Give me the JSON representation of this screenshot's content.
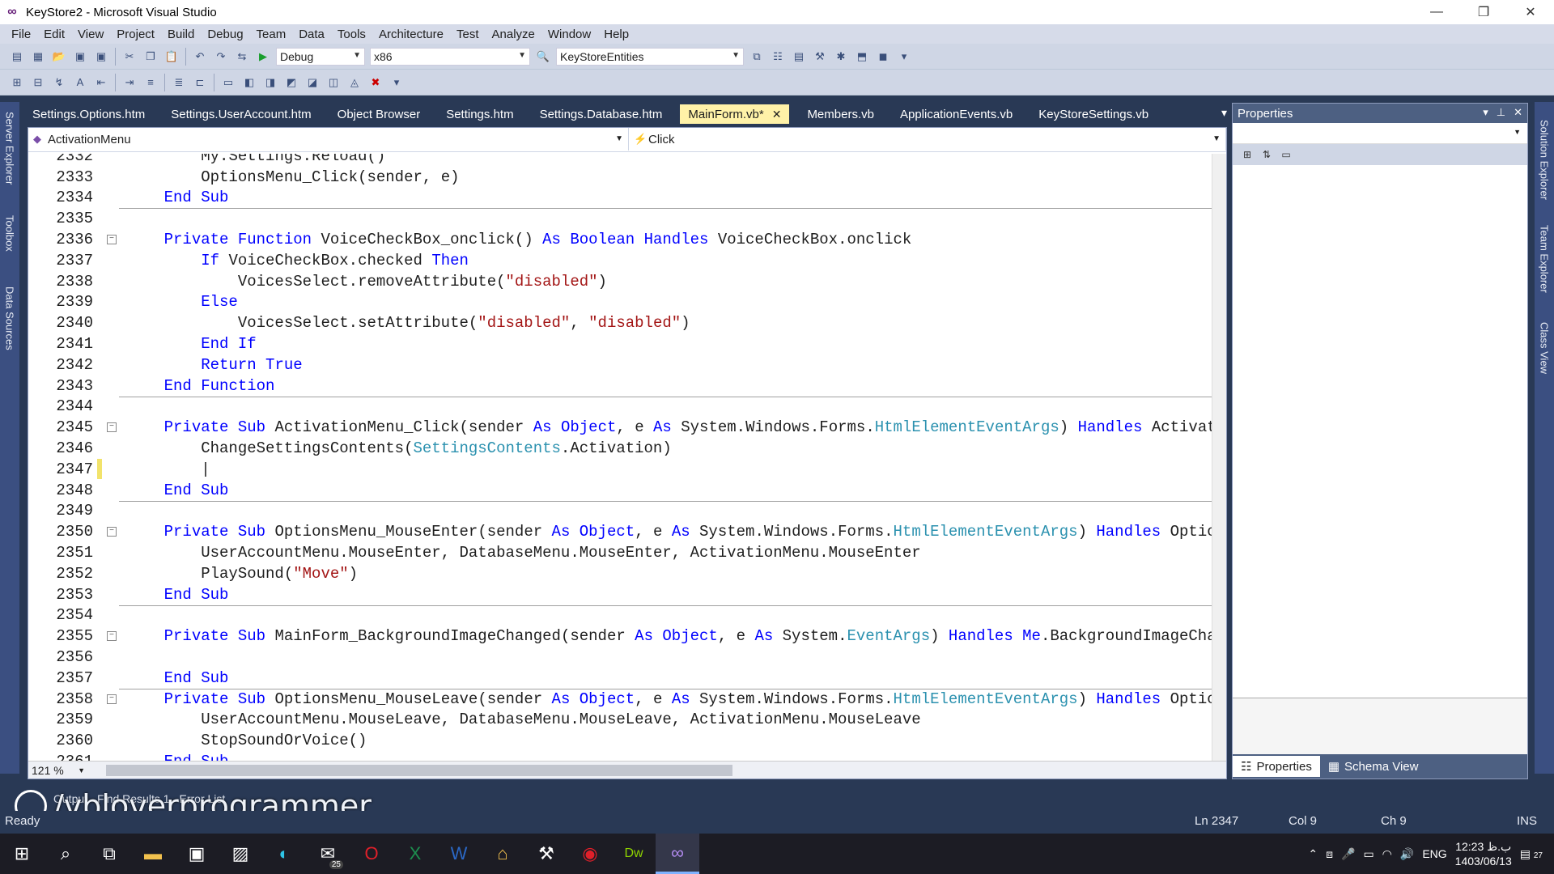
{
  "window": {
    "title": "KeyStore2 - Microsoft Visual Studio",
    "minimize": "—",
    "restore": "❐",
    "close": "✕"
  },
  "menu": [
    "File",
    "Edit",
    "View",
    "Project",
    "Build",
    "Debug",
    "Team",
    "Data",
    "Tools",
    "Architecture",
    "Test",
    "Analyze",
    "Window",
    "Help"
  ],
  "toolbar": {
    "config": "Debug",
    "platform": "x86",
    "object": "KeyStoreEntities"
  },
  "tabs": [
    {
      "label": "Settings.Options.htm",
      "active": false
    },
    {
      "label": "Settings.UserAccount.htm",
      "active": false
    },
    {
      "label": "Object Browser",
      "active": false
    },
    {
      "label": "Settings.htm",
      "active": false
    },
    {
      "label": "Settings.Database.htm",
      "active": false
    },
    {
      "label": "MainForm.vb*",
      "active": true
    },
    {
      "label": "Members.vb",
      "active": false
    },
    {
      "label": "ApplicationEvents.vb",
      "active": false
    },
    {
      "label": "KeyStoreSettings.vb",
      "active": false
    }
  ],
  "left_rail": [
    "Server Explorer",
    "Toolbox",
    "Data Sources"
  ],
  "right_rail": [
    "Solution Explorer",
    "Team Explorer",
    "Class View"
  ],
  "navbar": {
    "class_combo": "ActivationMenu",
    "member_combo": "Click"
  },
  "code_lines": [
    {
      "n": "2332",
      "text": "        My.Settings.Reload()"
    },
    {
      "n": "2333",
      "text": "        OptionsMenu_Click(sender, e)"
    },
    {
      "n": "2334",
      "text": "    End Sub"
    },
    {
      "n": "2335",
      "text": ""
    },
    {
      "n": "2336",
      "text": "    Private Function VoiceCheckBox_onclick() As Boolean Handles VoiceCheckBox.onclick",
      "fold": true
    },
    {
      "n": "2337",
      "text": "        If VoiceCheckBox.checked Then"
    },
    {
      "n": "2338",
      "text": "            VoicesSelect.removeAttribute(\"disabled\")"
    },
    {
      "n": "2339",
      "text": "        Else"
    },
    {
      "n": "2340",
      "text": "            VoicesSelect.setAttribute(\"disabled\", \"disabled\")"
    },
    {
      "n": "2341",
      "text": "        End If"
    },
    {
      "n": "2342",
      "text": "        Return True"
    },
    {
      "n": "2343",
      "text": "    End Function"
    },
    {
      "n": "2344",
      "text": ""
    },
    {
      "n": "2345",
      "text": "    Private Sub ActivationMenu_Click(sender As Object, e As System.Windows.Forms.HtmlElementEventArgs) Handles Activatio",
      "fold": true
    },
    {
      "n": "2346",
      "text": "        ChangeSettingsContents(SettingsContents.Activation)"
    },
    {
      "n": "2347",
      "text": "        |",
      "changed": true
    },
    {
      "n": "2348",
      "text": "    End Sub"
    },
    {
      "n": "2349",
      "text": ""
    },
    {
      "n": "2350",
      "text": "    Private Sub OptionsMenu_MouseEnter(sender As Object, e As System.Windows.Forms.HtmlElementEventArgs) Handles Options",
      "fold": true
    },
    {
      "n": "2351",
      "text": "        UserAccountMenu.MouseEnter, DatabaseMenu.MouseEnter, ActivationMenu.MouseEnter"
    },
    {
      "n": "2352",
      "text": "        PlaySound(\"Move\")"
    },
    {
      "n": "2353",
      "text": "    End Sub"
    },
    {
      "n": "2354",
      "text": ""
    },
    {
      "n": "2355",
      "text": "    Private Sub MainForm_BackgroundImageChanged(sender As Object, e As System.EventArgs) Handles Me.BackgroundImageChang",
      "fold": true
    },
    {
      "n": "2356",
      "text": ""
    },
    {
      "n": "2357",
      "text": "    End Sub"
    },
    {
      "n": "2358",
      "text": "    Private Sub OptionsMenu_MouseLeave(sender As Object, e As System.Windows.Forms.HtmlElementEventArgs) Handles Options",
      "fold": true
    },
    {
      "n": "2359",
      "text": "        UserAccountMenu.MouseLeave, DatabaseMenu.MouseLeave, ActivationMenu.MouseLeave"
    },
    {
      "n": "2360",
      "text": "        StopSoundOrVoice()"
    },
    {
      "n": "2361",
      "text": "    End Sub"
    }
  ],
  "zoom": "121 %",
  "properties": {
    "title": "Properties",
    "tab_properties": "Properties",
    "tab_schema": "Schema View"
  },
  "bottom_tabs": [
    "Output",
    "Find Results 1",
    "Error List"
  ],
  "status": {
    "ready": "Ready",
    "line": "Ln 2347",
    "col": "Col 9",
    "ch": "Ch 9",
    "mode": "INS"
  },
  "watermark": "/vbloverprogrammer",
  "taskbar": {
    "mail_badge": "25",
    "language": "ENG",
    "time": "12:23 ب.ظ",
    "date": "1403/06/13",
    "notifications": "27"
  }
}
